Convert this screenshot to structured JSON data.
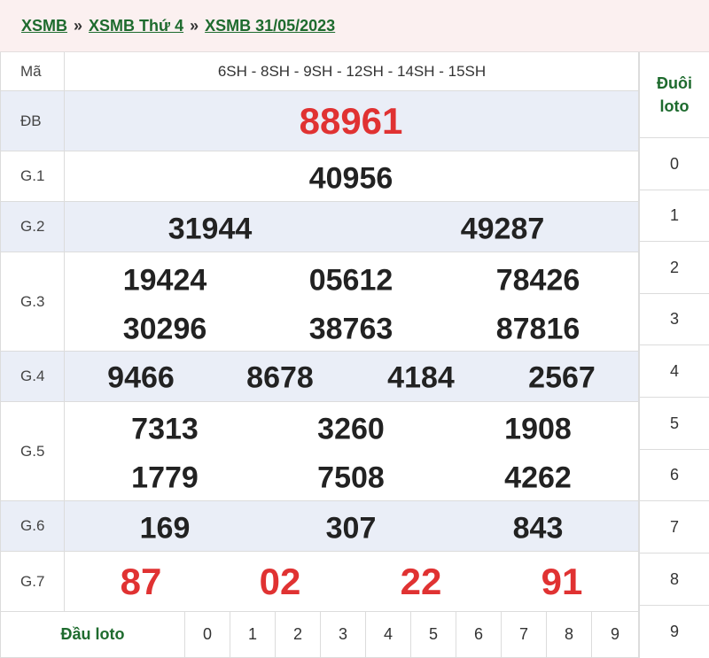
{
  "breadcrumb": {
    "home": "XSMB",
    "day": "XSMB Thứ 4",
    "date": "XSMB 31/05/2023",
    "separator": "»"
  },
  "table": {
    "ma_label": "Mã",
    "ma_value": "6SH - 8SH - 9SH - 12SH - 14SH - 15SH",
    "db_label": "ĐB",
    "db_value": "88961",
    "g1_label": "G.1",
    "g1": [
      "40956"
    ],
    "g2_label": "G.2",
    "g2": [
      "31944",
      "49287"
    ],
    "g3_label": "G.3",
    "g3": [
      "19424",
      "05612",
      "78426",
      "30296",
      "38763",
      "87816"
    ],
    "g4_label": "G.4",
    "g4": [
      "9466",
      "8678",
      "4184",
      "2567"
    ],
    "g5_label": "G.5",
    "g5": [
      "7313",
      "3260",
      "1908",
      "1779",
      "7508",
      "4262"
    ],
    "g6_label": "G.6",
    "g6": [
      "169",
      "307",
      "843"
    ],
    "g7_label": "G.7",
    "g7": [
      "87",
      "02",
      "22",
      "91"
    ]
  },
  "loto": {
    "duoi_header_line1": "Đuôi",
    "duoi_header_line2": "loto",
    "duoi_digits": [
      "0",
      "1",
      "2",
      "3",
      "4",
      "5",
      "6",
      "7",
      "8",
      "9"
    ],
    "dau_label": "Đầu loto",
    "dau_digits": [
      "0",
      "1",
      "2",
      "3",
      "4",
      "5",
      "6",
      "7",
      "8",
      "9"
    ]
  },
  "colors": {
    "accent_green": "#1e6b2e",
    "red": "#e03232",
    "row_shade": "#eaeef7",
    "breadcrumb_bg": "#fbf0f0"
  }
}
